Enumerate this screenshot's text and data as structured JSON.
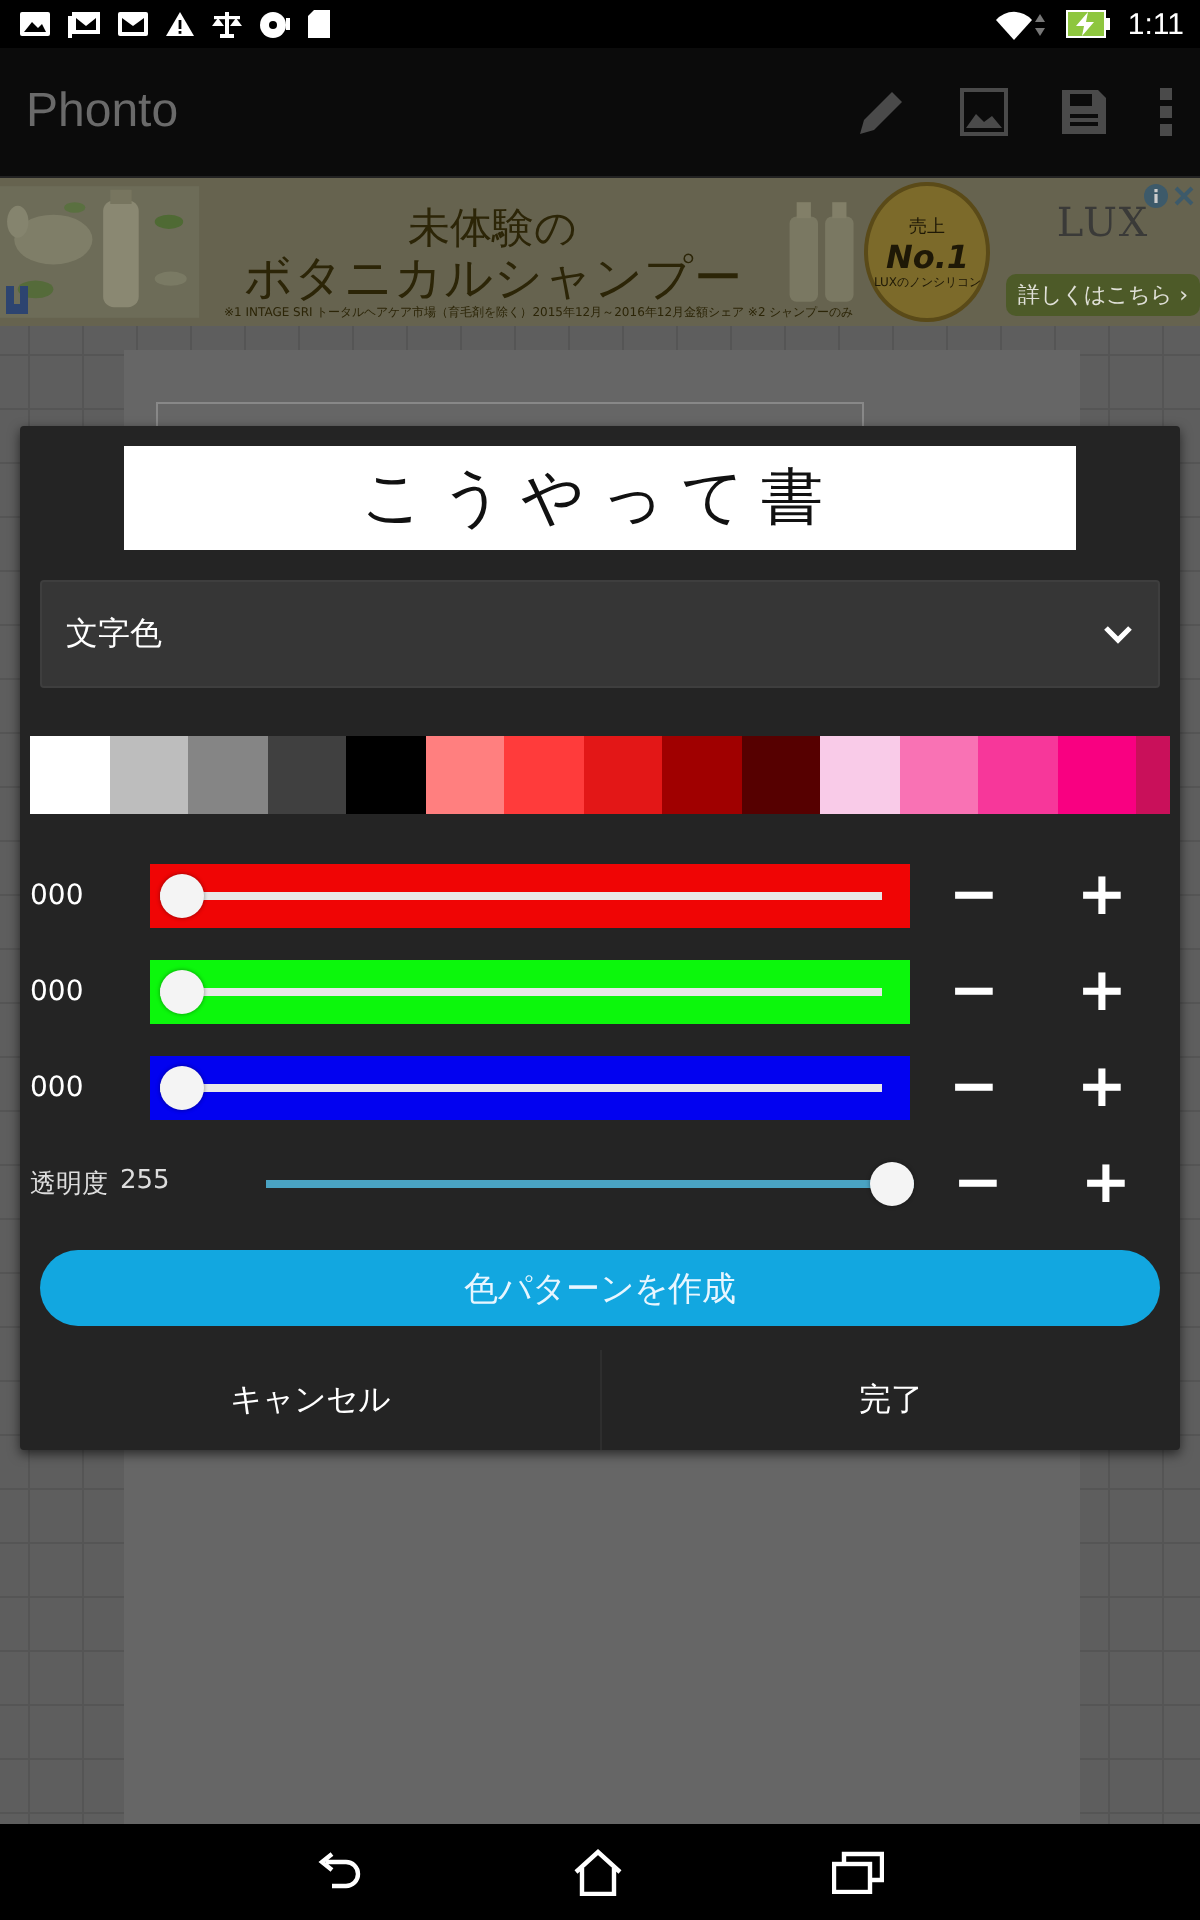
{
  "status_bar": {
    "time": "1:11"
  },
  "app_bar": {
    "title": "Phonto"
  },
  "ad": {
    "headline_1": "未体験の",
    "headline_2": "ボタニカルシャンプー",
    "footnote": "※1 INTAGE SRI トータルヘアケア市場（育毛剤を除く）2015年12月～2016年12月金額シェア ※2 シャンプーのみ",
    "medal_top": "売上",
    "medal_rank": "No.1",
    "medal_bottom": "LUXのノンシリコン",
    "brand": "LUX",
    "cta": "詳しくはこちら ›"
  },
  "dialog": {
    "preview_text": "こうやって書",
    "dropdown": {
      "value": "文字色"
    },
    "palette": [
      {
        "color": "#ffffff"
      },
      {
        "color": "#bdbdbd"
      },
      {
        "color": "#858585"
      },
      {
        "color": "#404040"
      },
      {
        "color": "#000000"
      },
      {
        "color": "#ff7f7f"
      },
      {
        "color": "#ff3b3b"
      },
      {
        "color": "#e31717"
      },
      {
        "color": "#a00000"
      },
      {
        "color": "#560000"
      },
      {
        "color": "#f9cbe8"
      },
      {
        "color": "#f972b4"
      },
      {
        "color": "#f7379a"
      },
      {
        "color": "#f90081"
      },
      {
        "color": "#c9105a"
      }
    ],
    "channels": [
      {
        "value": "000",
        "level": 0,
        "color": "#f00505",
        "minus": "−",
        "plus": "+"
      },
      {
        "value": "000",
        "level": 0,
        "color": "#0cf70c",
        "minus": "−",
        "plus": "+"
      },
      {
        "value": "000",
        "level": 0,
        "color": "#0202f0",
        "minus": "−",
        "plus": "+"
      }
    ],
    "alpha": {
      "label": "透明度",
      "value": "255",
      "level": 1,
      "minus": "−",
      "plus": "+"
    },
    "create_button": "色パターンを作成",
    "buttons": [
      "キャンセル",
      "完了"
    ]
  }
}
